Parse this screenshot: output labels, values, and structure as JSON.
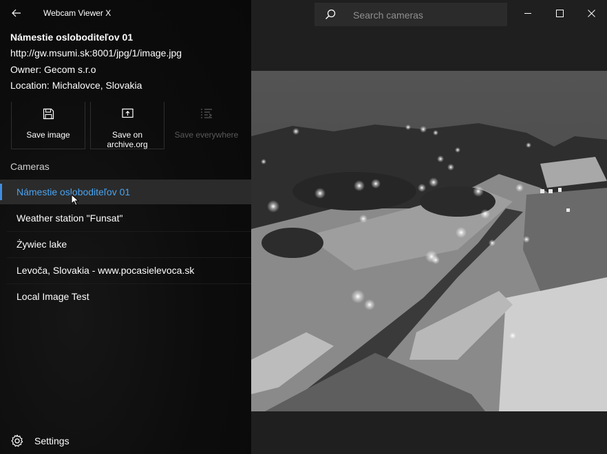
{
  "app": {
    "title": "Webcam Viewer X"
  },
  "camera_info": {
    "name": "Námestie osloboditeľov 01",
    "url": "http://gw.msumi.sk:8001/jpg/1/image.jpg",
    "owner": "Owner: Gecom s.r.o",
    "location": "Location: Michalovce, Slovakia"
  },
  "actions": [
    {
      "label": "Save image",
      "icon": "save-icon",
      "enabled": true
    },
    {
      "label": "Save on archive.org",
      "icon": "upload-icon",
      "enabled": true
    },
    {
      "label": "Save everywhere",
      "icon": "list-icon",
      "enabled": false
    }
  ],
  "cameras_section": {
    "label": "Cameras"
  },
  "cameras": [
    {
      "name": "Námestie osloboditeľov 01",
      "selected": true
    },
    {
      "name": "Weather station \"Funsat\"",
      "selected": false
    },
    {
      "name": "Żywiec lake",
      "selected": false
    },
    {
      "name": "Levoča, Slovakia - www.pocasielevoca.sk",
      "selected": false
    },
    {
      "name": "Local Image Test",
      "selected": false
    }
  ],
  "settings": {
    "label": "Settings",
    "icon": "gear-icon"
  },
  "search": {
    "placeholder": "Search cameras"
  },
  "colors": {
    "accent": "#3f8fe0",
    "selected_text": "#4aa3f0",
    "sidebar_bg": "#0b0b0b",
    "main_bg": "#1f1f1f"
  }
}
